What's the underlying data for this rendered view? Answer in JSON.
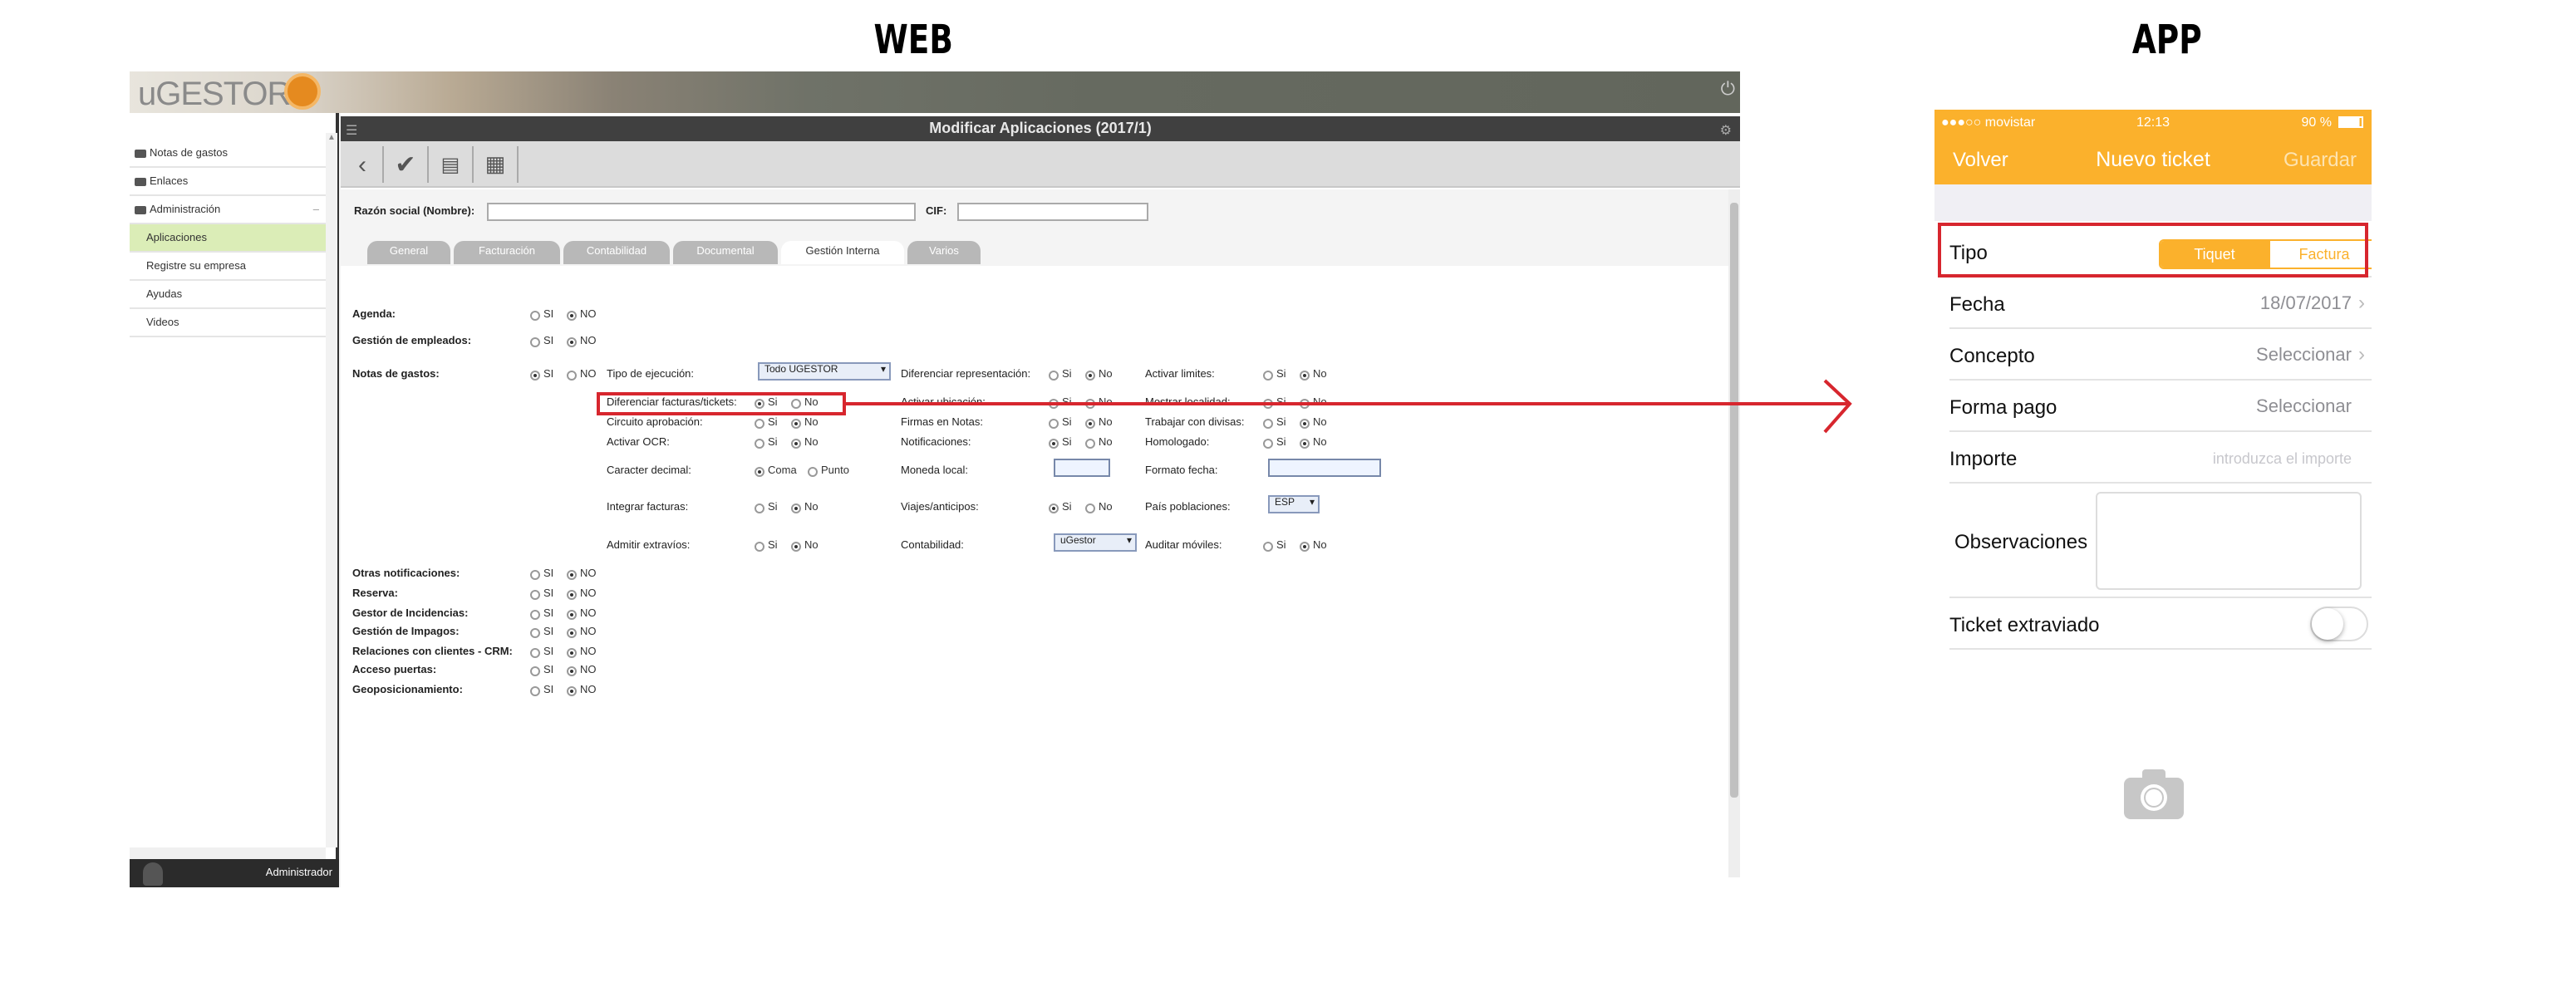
{
  "headings": {
    "web": "WEB",
    "app": "APP"
  },
  "web": {
    "logo": "uGESTOR",
    "title": "Modificar Aplicaciones (2017/1)",
    "sidebar": {
      "items": [
        {
          "label": "Notas de gastos"
        },
        {
          "label": "Enlaces"
        },
        {
          "label": "Administración"
        },
        {
          "label": "Aplicaciones"
        },
        {
          "label": "Registre su empresa"
        },
        {
          "label": "Ayudas"
        },
        {
          "label": "Videos"
        }
      ],
      "footer_user": "Administrador"
    },
    "form": {
      "razon_label": "Razón social (Nombre):",
      "cif_label": "CIF:"
    },
    "tabs": [
      "General",
      "Facturación",
      "Contabilidad",
      "Documental",
      "Gestión Interna",
      "Varios"
    ],
    "radio": {
      "si": "SI",
      "no": "NO",
      "si2": "Si",
      "no2": "No",
      "coma": "Coma",
      "punto": "Punto"
    },
    "labels": {
      "agenda": "Agenda:",
      "empleados": "Gestión de empleados:",
      "notas": "Notas de gastos:",
      "tipo_ejec": "Tipo de ejecución:",
      "dif_fact": "Diferenciar facturas/tickets:",
      "circuito": "Circuito aprobación:",
      "ocr": "Activar OCR:",
      "caracter": "Caracter decimal:",
      "integrar": "Integrar facturas:",
      "extravios": "Admitir extravíos:",
      "dif_rep": "Diferenciar representación:",
      "act_ubic": "Activar ubicación:",
      "firmas": "Firmas en Notas:",
      "notif": "Notificaciones:",
      "moneda": "Moneda local:",
      "viajes": "Viajes/anticipos:",
      "contab": "Contabilidad:",
      "limites": "Activar limites:",
      "mostrar": "Mostrar localidad:",
      "divisas": "Trabajar con divisas:",
      "homolog": "Homologado:",
      "formato": "Formato fecha:",
      "pais": "País poblaciones:",
      "auditar": "Auditar móviles:",
      "otras": "Otras notificaciones:",
      "reserva": "Reserva:",
      "incid": "Gestor de Incidencias:",
      "impagos": "Gestión de Impagos:",
      "crm": "Relaciones con clientes - CRM:",
      "acceso": "Acceso puertas:",
      "geo": "Geoposicionamiento:"
    },
    "selects": {
      "tipo": "Todo UGESTOR",
      "pais": "ESP",
      "contab": "uGestor"
    }
  },
  "app": {
    "status": {
      "carrier": "●●●○○ movistar",
      "time": "12:13",
      "battery": "90 %"
    },
    "nav": {
      "back": "Volver",
      "title": "Nuevo ticket",
      "save": "Guardar"
    },
    "rows": {
      "tipo": "Tipo",
      "seg_left": "Tiquet",
      "seg_right": "Factura",
      "fecha": "Fecha",
      "fecha_val": "18/07/2017",
      "concepto": "Concepto",
      "concepto_val": "Seleccionar",
      "forma": "Forma pago",
      "forma_val": "Seleccionar",
      "importe": "Importe",
      "importe_ph": "introduzca el importe",
      "obs": "Observaciones",
      "extraviado": "Ticket extraviado"
    },
    "colors": {
      "accent": "#fbb12c",
      "highlight": "#d7262e"
    }
  }
}
